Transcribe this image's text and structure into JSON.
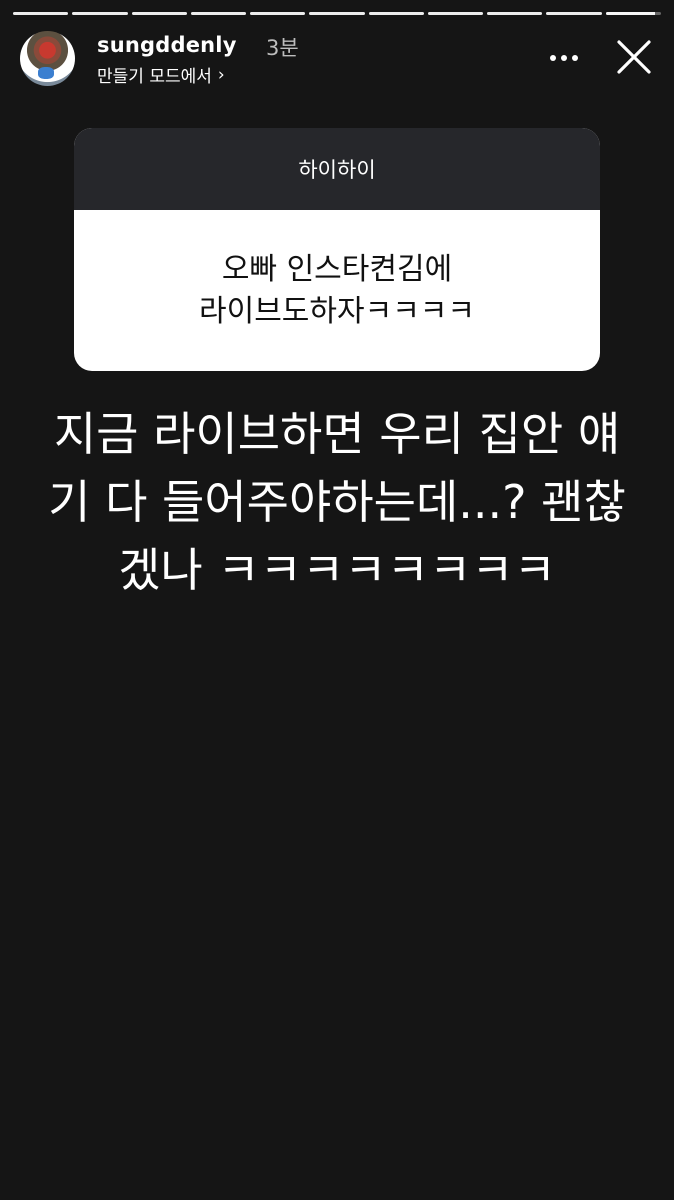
{
  "story": {
    "progress_segments": 11,
    "current_segment_fill": 0.9
  },
  "header": {
    "username": "sungddenly",
    "time_ago": "3분",
    "subtitle": "만들기 모드에서",
    "subtitle_chevron": "›",
    "more_icon": "more-horizontal-icon",
    "close_icon": "close-icon"
  },
  "question_card": {
    "title": "하이하이",
    "question_line1": "오빠 인스타켠김에",
    "question_line2": "라이브도하자ㅋㅋㅋㅋ"
  },
  "caption": {
    "line1": "지금 라이브하면 우리 집안 얘",
    "line2": "기 다 들어주야하는데...? 괜찮",
    "line3": "겠나 ㅋㅋㅋㅋㅋㅋㅋㅋ"
  },
  "colors": {
    "background": "#151515",
    "card_header": "#26272b",
    "card_body": "#ffffff"
  }
}
